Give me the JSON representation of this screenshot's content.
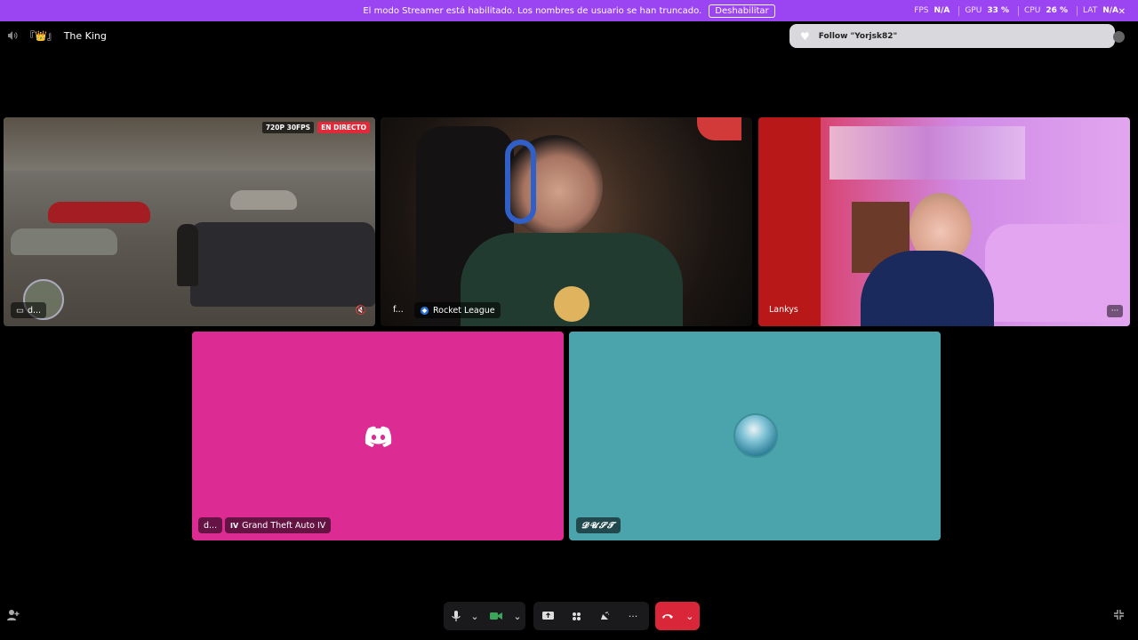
{
  "banner": {
    "message": "El modo Streamer está habilitado. Los nombres de usuario se han truncado.",
    "button": "Deshabilitar",
    "stats": [
      {
        "label": "FPS",
        "value": "N/A"
      },
      {
        "label": "GPU",
        "value": "33 %"
      },
      {
        "label": "CPU",
        "value": "26 %"
      },
      {
        "label": "LAT",
        "value": "N/A"
      }
    ],
    "close_glyph": "✕",
    "bg_color": "#9b44f2"
  },
  "header": {
    "speaker_icon": "speaker-icon",
    "channel_prefix": "『👑』",
    "channel_name": "The King"
  },
  "toast": {
    "icon": "heart-icon",
    "text": "Follow \"Yorjsk82\""
  },
  "tiles": [
    {
      "id": "stream",
      "badge_quality": "720P 30FPS",
      "badge_live": "EN DIRECTO",
      "name": "d..."
    },
    {
      "id": "cam-1",
      "name": "f...",
      "activity": "Rocket League"
    },
    {
      "id": "cam-2",
      "name": "Lankys"
    },
    {
      "id": "user-1",
      "name": "d...",
      "activity": "Grand Theft Auto IV",
      "bg_color": "#dd2b94"
    },
    {
      "id": "user-2",
      "name": "𝓓𝓤𝓢𝓣",
      "bg_color": "#4ba3ac"
    }
  ],
  "controls": {
    "mic_icon": "microphone-icon",
    "camera_icon": "video-camera-icon",
    "screenshare_icon": "screen-share-icon",
    "activities_icon": "activities-icon",
    "soundboard_icon": "soundboard-icon",
    "more_glyph": "···",
    "hangup_icon": "hang-up-icon",
    "hangup_color": "#d92638"
  },
  "corners": {
    "invite_icon": "add-user-icon",
    "fullscreen_icon": "exit-fullscreen-icon"
  }
}
